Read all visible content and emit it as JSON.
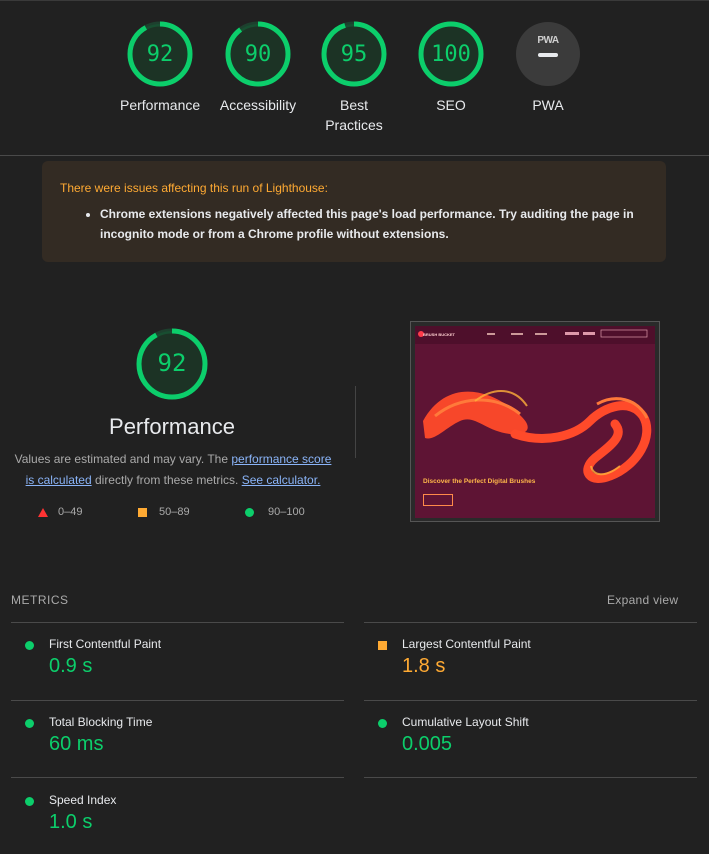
{
  "scores": [
    {
      "value": "92",
      "label": "Performance",
      "fraction": 0.92
    },
    {
      "value": "90",
      "label": "Accessibility",
      "fraction": 0.9
    },
    {
      "value": "95",
      "label": "Best Practices",
      "fraction": 0.95
    },
    {
      "value": "100",
      "label": "SEO",
      "fraction": 1.0
    }
  ],
  "pwa": {
    "badge": "PWA",
    "label": "PWA"
  },
  "warning": {
    "heading": "There were issues affecting this run of Lighthouse:",
    "item": "Chrome extensions negatively affected this page's load performance. Try auditing the page in incognito mode or from a Chrome profile without extensions."
  },
  "performance": {
    "score": "92",
    "fraction": 0.92,
    "title": "Performance",
    "desc_pre": "Values are estimated and may vary. The ",
    "link1": "performance score is calculated",
    "desc_mid": " directly from these metrics. ",
    "link2": "See calculator.",
    "legend": {
      "fail": "0–49",
      "average": "50–89",
      "pass": "90–100"
    }
  },
  "screenshot": {
    "brand": "BRUSH BUCKET",
    "headline": "Discover the Perfect Digital Brushes"
  },
  "metrics": {
    "title": "METRICS",
    "expand": "Expand view",
    "items": [
      {
        "name": "First Contentful Paint",
        "value": "0.9 s",
        "rating": "pass"
      },
      {
        "name": "Largest Contentful Paint",
        "value": "1.8 s",
        "rating": "average"
      },
      {
        "name": "Total Blocking Time",
        "value": "60 ms",
        "rating": "pass"
      },
      {
        "name": "Cumulative Layout Shift",
        "value": "0.005",
        "rating": "pass"
      },
      {
        "name": "Speed Index",
        "value": "1.0 s",
        "rating": "pass"
      }
    ]
  },
  "colors": {
    "pass": "#0cce6b",
    "average": "#ffaa33",
    "fail": "#ff3333",
    "background": "#212121"
  }
}
